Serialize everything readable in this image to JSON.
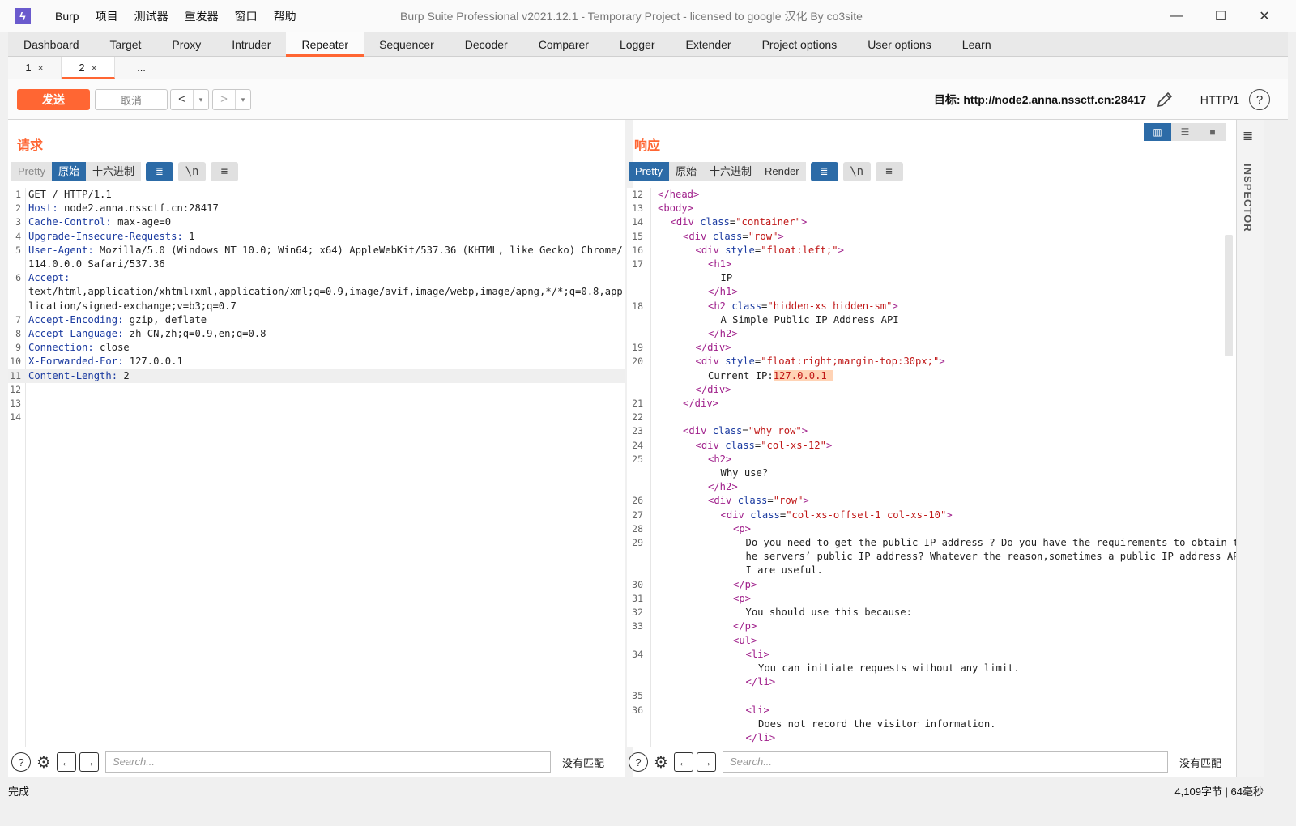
{
  "app": {
    "logo_glyph": "ϟ",
    "title": "Burp Suite Professional v2021.12.1 - Temporary Project - licensed to google 汉化 By co3site",
    "menu": [
      "Burp",
      "项目",
      "测试器",
      "重发器",
      "窗口",
      "帮助"
    ],
    "controls": {
      "minimize": "—",
      "maximize": "☐",
      "close": "✕"
    }
  },
  "main_tabs": [
    "Dashboard",
    "Target",
    "Proxy",
    "Intruder",
    "Repeater",
    "Sequencer",
    "Decoder",
    "Comparer",
    "Logger",
    "Extender",
    "Project options",
    "User options",
    "Learn"
  ],
  "active_main_tab": "Repeater",
  "sub_tabs": [
    {
      "label": "1",
      "close": "×"
    },
    {
      "label": "2",
      "close": "×"
    },
    {
      "label": "...",
      "close": ""
    }
  ],
  "toolbar": {
    "send_label": "发送",
    "cancel_label": "取消",
    "back_glyph": "<",
    "forward_glyph": ">",
    "drop_glyph": "▾",
    "target_text": "目标: http://node2.anna.nssctf.cn:28417",
    "http_version": "HTTP/1",
    "help_glyph": "?"
  },
  "request": {
    "title": "请求",
    "view_tabs": [
      "Pretty",
      "原始",
      "十六进制"
    ],
    "active_view": "原始",
    "icons": {
      "wrap": "≣",
      "newline": "\\n",
      "menu": "≡"
    },
    "lines": [
      {
        "n": "1",
        "key": "",
        "val": "GET / HTTP/1.1"
      },
      {
        "n": "2",
        "key": "Host",
        "val": " node2.anna.nssctf.cn:28417"
      },
      {
        "n": "3",
        "key": "Cache-Control",
        "val": " max-age=0"
      },
      {
        "n": "4",
        "key": "Upgrade-Insecure-Requests",
        "val": " 1"
      },
      {
        "n": "5",
        "key": "User-Agent",
        "val": " Mozilla/5.0 (Windows NT 10.0; Win64; x64) AppleWebKit/537.36 (KHTML, like Gecko) Chrome/114.0.0.0 Safari/537.36"
      },
      {
        "n": "6",
        "key": "Accept",
        "val": "\ntext/html,application/xhtml+xml,application/xml;q=0.9,image/avif,image/webp,image/apng,*/*;q=0.8,application/signed-exchange;v=b3;q=0.7"
      },
      {
        "n": "7",
        "key": "Accept-Encoding",
        "val": " gzip, deflate"
      },
      {
        "n": "8",
        "key": "Accept-Language",
        "val": " zh-CN,zh;q=0.9,en;q=0.8"
      },
      {
        "n": "9",
        "key": "Connection",
        "val": " close"
      },
      {
        "n": "10",
        "key": "X-Forwarded-For",
        "val": " 127.0.0.1"
      },
      {
        "n": "11",
        "key": "Content-Length",
        "val": " 2"
      },
      {
        "n": "12",
        "key": "",
        "val": ""
      },
      {
        "n": "13",
        "key": "",
        "val": ""
      },
      {
        "n": "14",
        "key": "",
        "val": ""
      }
    ],
    "search_placeholder": "Search...",
    "no_match": "没有匹配"
  },
  "response": {
    "title": "响应",
    "view_tabs": [
      "Pretty",
      "原始",
      "十六进制",
      "Render"
    ],
    "active_view": "Pretty",
    "icons": {
      "wrap": "≣",
      "newline": "\\n",
      "menu": "≡"
    },
    "lines": [
      {
        "n": "12",
        "indent": 0,
        "parts": [
          [
            "t",
            "</head>"
          ]
        ]
      },
      {
        "n": "13",
        "indent": 0,
        "parts": [
          [
            "t",
            "<body>"
          ]
        ]
      },
      {
        "n": "14",
        "indent": 1,
        "parts": [
          [
            "t",
            "<div "
          ],
          [
            "a",
            "class"
          ],
          [
            "p",
            "="
          ],
          [
            "s",
            "\"container\""
          ],
          [
            "t",
            ">"
          ]
        ]
      },
      {
        "n": "15",
        "indent": 2,
        "parts": [
          [
            "t",
            "<div "
          ],
          [
            "a",
            "class"
          ],
          [
            "p",
            "="
          ],
          [
            "s",
            "\"row\""
          ],
          [
            "t",
            ">"
          ]
        ]
      },
      {
        "n": "16",
        "indent": 3,
        "parts": [
          [
            "t",
            "<div "
          ],
          [
            "a",
            "style"
          ],
          [
            "p",
            "="
          ],
          [
            "s",
            "\"float:left;\""
          ],
          [
            "t",
            ">"
          ]
        ]
      },
      {
        "n": "17",
        "indent": 4,
        "parts": [
          [
            "t",
            "<h1>"
          ]
        ]
      },
      {
        "n": "",
        "indent": 5,
        "parts": [
          [
            "p",
            "IP"
          ]
        ]
      },
      {
        "n": "",
        "indent": 4,
        "parts": [
          [
            "t",
            "</h1>"
          ]
        ]
      },
      {
        "n": "18",
        "indent": 4,
        "parts": [
          [
            "t",
            "<h2 "
          ],
          [
            "a",
            "class"
          ],
          [
            "p",
            "="
          ],
          [
            "s",
            "\"hidden-xs hidden-sm\""
          ],
          [
            "t",
            ">"
          ]
        ]
      },
      {
        "n": "",
        "indent": 5,
        "parts": [
          [
            "p",
            "A Simple Public IP Address API"
          ]
        ]
      },
      {
        "n": "",
        "indent": 4,
        "parts": [
          [
            "t",
            "</h2>"
          ]
        ]
      },
      {
        "n": "19",
        "indent": 3,
        "parts": [
          [
            "t",
            "</div>"
          ]
        ]
      },
      {
        "n": "20",
        "indent": 3,
        "parts": [
          [
            "t",
            "<div "
          ],
          [
            "a",
            "style"
          ],
          [
            "p",
            "="
          ],
          [
            "s",
            "\"float:right;margin-top:30px;\""
          ],
          [
            "t",
            ">"
          ]
        ]
      },
      {
        "n": "",
        "indent": 4,
        "parts": [
          [
            "p",
            "Current IP:"
          ],
          [
            "h",
            "127.0.0.1 "
          ]
        ]
      },
      {
        "n": "",
        "indent": 3,
        "parts": [
          [
            "t",
            "</div>"
          ]
        ]
      },
      {
        "n": "21",
        "indent": 2,
        "parts": [
          [
            "t",
            "</div>"
          ]
        ]
      },
      {
        "n": "22",
        "indent": 0,
        "parts": [
          [
            "p",
            ""
          ]
        ]
      },
      {
        "n": "23",
        "indent": 2,
        "parts": [
          [
            "t",
            "<div "
          ],
          [
            "a",
            "class"
          ],
          [
            "p",
            "="
          ],
          [
            "s",
            "\"why row\""
          ],
          [
            "t",
            ">"
          ]
        ]
      },
      {
        "n": "24",
        "indent": 3,
        "parts": [
          [
            "t",
            "<div "
          ],
          [
            "a",
            "class"
          ],
          [
            "p",
            "="
          ],
          [
            "s",
            "\"col-xs-12\""
          ],
          [
            "t",
            ">"
          ]
        ]
      },
      {
        "n": "25",
        "indent": 4,
        "parts": [
          [
            "t",
            "<h2>"
          ]
        ]
      },
      {
        "n": "",
        "indent": 5,
        "parts": [
          [
            "p",
            "Why use?"
          ]
        ]
      },
      {
        "n": "",
        "indent": 4,
        "parts": [
          [
            "t",
            "</h2>"
          ]
        ]
      },
      {
        "n": "26",
        "indent": 4,
        "parts": [
          [
            "t",
            "<div "
          ],
          [
            "a",
            "class"
          ],
          [
            "p",
            "="
          ],
          [
            "s",
            "\"row\""
          ],
          [
            "t",
            ">"
          ]
        ]
      },
      {
        "n": "27",
        "indent": 5,
        "parts": [
          [
            "t",
            "<div "
          ],
          [
            "a",
            "class"
          ],
          [
            "p",
            "="
          ],
          [
            "s",
            "\"col-xs-offset-1 col-xs-10\""
          ],
          [
            "t",
            ">"
          ]
        ]
      },
      {
        "n": "28",
        "indent": 6,
        "parts": [
          [
            "t",
            "<p>"
          ]
        ]
      },
      {
        "n": "29",
        "indent": 7,
        "parts": [
          [
            "p",
            "Do you need to get the public IP address ? Do you have the requirements to obtain the servers’ public IP address? Whatever the reason,sometimes a public IP address API are useful."
          ]
        ]
      },
      {
        "n": "30",
        "indent": 6,
        "parts": [
          [
            "t",
            "</p>"
          ]
        ]
      },
      {
        "n": "31",
        "indent": 6,
        "parts": [
          [
            "t",
            "<p>"
          ]
        ]
      },
      {
        "n": "32",
        "indent": 7,
        "parts": [
          [
            "p",
            "You should use this because:"
          ]
        ]
      },
      {
        "n": "33",
        "indent": 6,
        "parts": [
          [
            "t",
            "</p>"
          ]
        ]
      },
      {
        "n": "",
        "indent": 6,
        "parts": [
          [
            "t",
            "<ul>"
          ]
        ]
      },
      {
        "n": "34",
        "indent": 7,
        "parts": [
          [
            "t",
            "<li>"
          ]
        ]
      },
      {
        "n": "",
        "indent": 8,
        "parts": [
          [
            "p",
            "You can initiate requests without any limit."
          ]
        ]
      },
      {
        "n": "",
        "indent": 7,
        "parts": [
          [
            "t",
            "</li>"
          ]
        ]
      },
      {
        "n": "35",
        "indent": 0,
        "parts": [
          [
            "p",
            ""
          ]
        ]
      },
      {
        "n": "36",
        "indent": 7,
        "parts": [
          [
            "t",
            "<li>"
          ]
        ]
      },
      {
        "n": "",
        "indent": 8,
        "parts": [
          [
            "p",
            "Does not record the visitor information."
          ]
        ]
      },
      {
        "n": "",
        "indent": 7,
        "parts": [
          [
            "t",
            "</li>"
          ]
        ]
      }
    ],
    "search_placeholder": "Search...",
    "no_match": "没有匹配"
  },
  "inspector": {
    "label": "INSPECTOR",
    "menu_glyph": "≣"
  },
  "layout_toggle": [
    "▥",
    "☰",
    "■"
  ],
  "searchbar_icons": {
    "help": "?",
    "settings": "⚙",
    "prev": "←",
    "next": "→"
  },
  "status": {
    "left": "完成",
    "right": "4,109字节 | 64毫秒"
  },
  "splitter_glyph": "⋮",
  "colors": {
    "accent": "#ff6633",
    "active_blue": "#2c6ba7",
    "tag": "#a0208b",
    "attr": "#1a3aa0",
    "string": "#c01818",
    "highlight": "#ffd3b5"
  }
}
